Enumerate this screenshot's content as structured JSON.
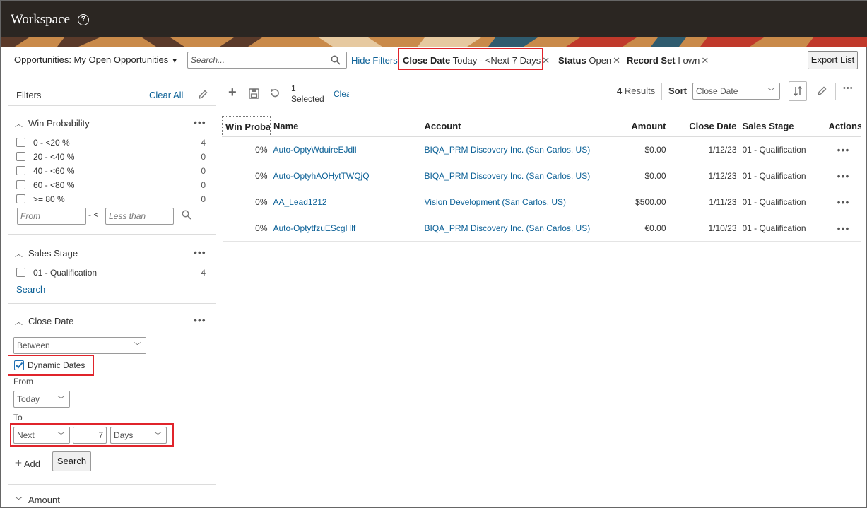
{
  "header": {
    "title": "Workspace",
    "help_icon": "help-circle-icon"
  },
  "filter_bar": {
    "saved_search": "Opportunities: My Open Opportunities",
    "search_placeholder": "Search...",
    "hide_filters": "Hide Filters",
    "chips": [
      {
        "label": "Close Date",
        "value": "Today - <Next 7 Days"
      },
      {
        "label": "Status",
        "value": "Open"
      },
      {
        "label": "Record Set",
        "value": "I own"
      }
    ],
    "export": "Export List"
  },
  "filters_panel": {
    "title": "Filters",
    "clear_all": "Clear All",
    "win_probability": {
      "title": "Win Probability",
      "options": [
        {
          "label": "0 - <20 %",
          "count": "4"
        },
        {
          "label": "20 - <40 %",
          "count": "0"
        },
        {
          "label": "40 - <60 %",
          "count": "0"
        },
        {
          "label": "60 - <80 %",
          "count": "0"
        },
        {
          "label": ">= 80 %",
          "count": "0"
        }
      ],
      "from_placeholder": "From",
      "range_sep": "- <",
      "to_placeholder": "Less than"
    },
    "sales_stage": {
      "title": "Sales Stage",
      "options": [
        {
          "label": "01 - Qualification",
          "count": "4"
        }
      ],
      "search_link": "Search"
    },
    "close_date": {
      "title": "Close Date",
      "operator": "Between",
      "dynamic_dates_label": "Dynamic Dates",
      "dynamic_dates_checked": true,
      "from_label": "From",
      "from_value": "Today",
      "to_label": "To",
      "to_direction": "Next",
      "to_amount": "7",
      "to_unit": "Days",
      "add_label": "Add",
      "search_button": "Search"
    },
    "amount": {
      "title": "Amount"
    }
  },
  "toolbar": {
    "selected_count": "1",
    "selected_label": "Selected",
    "clear": "Clear",
    "results_count": "4",
    "results_label": "Results",
    "sort_label": "Sort",
    "sort_value": "Close Date"
  },
  "table": {
    "columns": [
      "Win Probability",
      "Name",
      "Account",
      "Amount",
      "Close Date",
      "Sales Stage",
      "Actions"
    ],
    "rows": [
      {
        "win": "0%",
        "name": "Auto-OptyWduireEJdll",
        "account": "BIQA_PRM Discovery Inc. (San Carlos, US)",
        "amount": "$0.00",
        "close": "1/12/23",
        "stage": "01 - Qualification",
        "actions": "•••"
      },
      {
        "win": "0%",
        "name": "Auto-OptyhAOHytTWQjQ",
        "account": "BIQA_PRM Discovery Inc. (San Carlos, US)",
        "amount": "$0.00",
        "close": "1/12/23",
        "stage": "01 - Qualification",
        "actions": "•••"
      },
      {
        "win": "0%",
        "name": "AA_Lead1212",
        "account": "Vision Development (San Carlos, US)",
        "amount": "$500.00",
        "close": "1/11/23",
        "stage": "01 - Qualification",
        "actions": "•••"
      },
      {
        "win": "0%",
        "name": "Auto-OptytfzuEScgHlf",
        "account": "BIQA_PRM Discovery Inc. (San Carlos, US)",
        "amount": "€0.00",
        "close": "1/10/23",
        "stage": "01 - Qualification",
        "actions": "•••"
      }
    ]
  },
  "colors": {
    "link": "#0b6096",
    "highlight": "#e0242b",
    "header_bg": "#2b2622"
  }
}
